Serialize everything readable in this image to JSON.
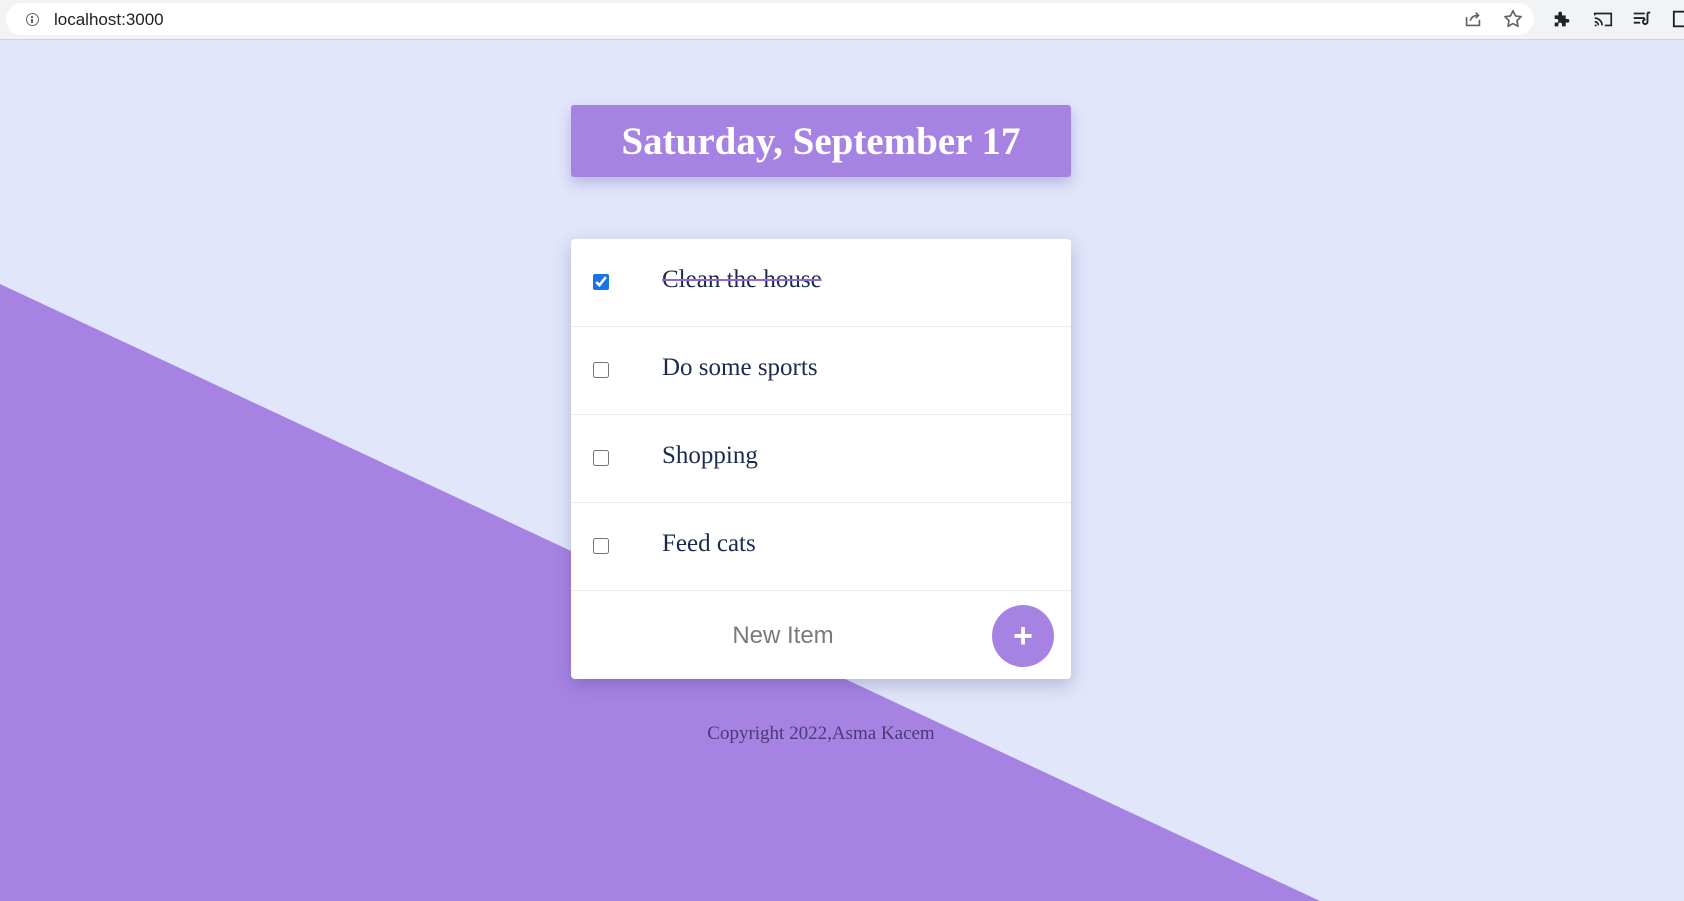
{
  "browser": {
    "url": "localhost:3000",
    "icons": [
      "info-icon",
      "share-icon",
      "star-icon",
      "extensions-icon",
      "cast-icon",
      "media-queue-icon",
      "side-panel-icon"
    ]
  },
  "colors": {
    "accent": "#a683e3",
    "background": "#e2e6fb",
    "card": "#ffffff",
    "text": "#1c2a4e"
  },
  "header": {
    "date": "Saturday, September 17"
  },
  "todos": [
    {
      "text": "Clean the house",
      "checked": true
    },
    {
      "text": "Do some sports",
      "checked": false
    },
    {
      "text": "Shopping",
      "checked": false
    },
    {
      "text": "Feed cats",
      "checked": false
    }
  ],
  "new_item": {
    "placeholder": "New Item",
    "add_label": "+"
  },
  "footer": {
    "copyright": "Copyright 2022,Asma Kacem"
  }
}
